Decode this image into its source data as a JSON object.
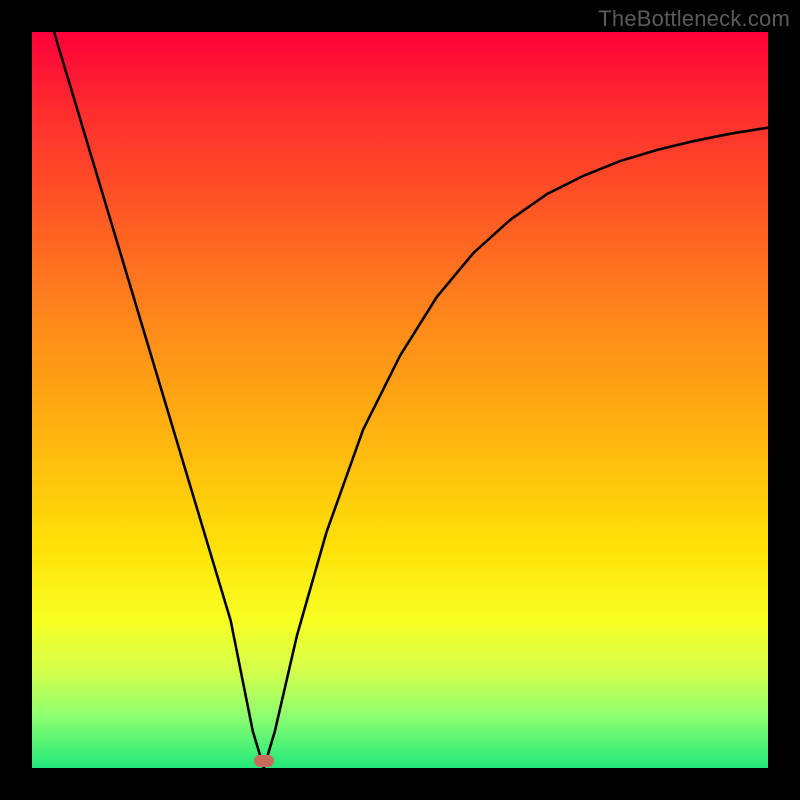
{
  "watermark": "TheBottleneck.com",
  "chart_data": {
    "type": "line",
    "title": "",
    "xlabel": "",
    "ylabel": "",
    "xlim": [
      0,
      100
    ],
    "ylim": [
      0,
      100
    ],
    "series": [
      {
        "name": "curve",
        "x": [
          3,
          6,
          9,
          12,
          15,
          18,
          21,
          24,
          27,
          30,
          31.5,
          33,
          36,
          40,
          45,
          50,
          55,
          60,
          65,
          70,
          75,
          80,
          85,
          90,
          95,
          100
        ],
        "y": [
          100,
          90,
          80,
          70,
          60,
          50,
          40,
          30,
          20,
          5,
          0,
          5,
          18,
          32,
          46,
          56,
          64,
          70,
          74.5,
          78,
          80.5,
          82.5,
          84,
          85.2,
          86.2,
          87
        ]
      }
    ],
    "marker": {
      "x": 31.5,
      "y": 1.0,
      "color": "#c96a5e"
    },
    "colors": {
      "curve_stroke": "#000000",
      "marker_fill": "#c96a5e",
      "background_frame": "#000000"
    }
  }
}
